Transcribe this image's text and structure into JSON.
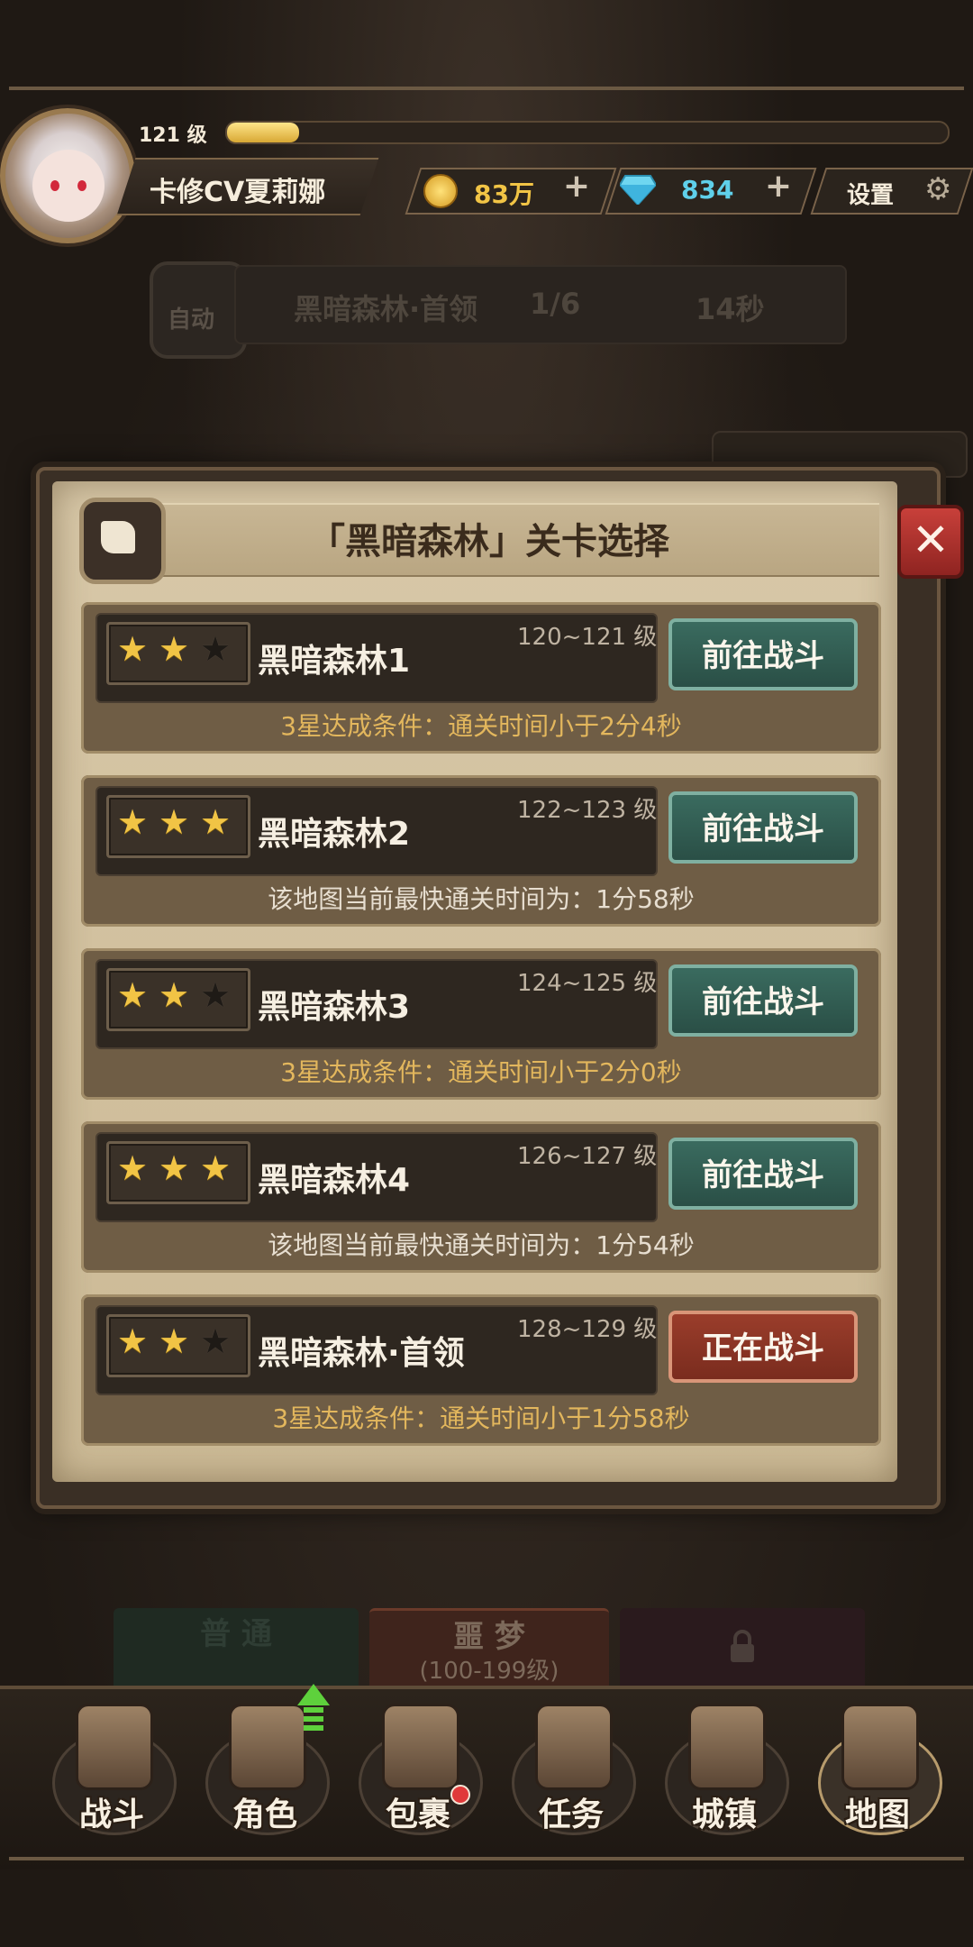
{
  "player": {
    "level_label": "121 级",
    "exp_fraction": 0.1,
    "name": "卡修CV夏莉娜"
  },
  "resources": {
    "gold": "83万",
    "diamonds": "834",
    "settings_label": "设置",
    "plus_label": "+"
  },
  "auto_battle": {
    "badge": "自动",
    "stage": "黑暗森林·首领",
    "progress": "1/6",
    "timer": "14秒"
  },
  "modal": {
    "title": "「黑暗森林」关卡选择",
    "close_label": "✕",
    "levels": [
      {
        "name": "黑暗森林1",
        "range": "120~121 级",
        "stars": 2,
        "button": "前往战斗",
        "button_style": "green",
        "note": "3星达成条件：通关时间小于2分4秒",
        "note_style": "gold"
      },
      {
        "name": "黑暗森林2",
        "range": "122~123 级",
        "stars": 3,
        "button": "前往战斗",
        "button_style": "green",
        "note": "该地图当前最快通关时间为：1分58秒",
        "note_style": "white"
      },
      {
        "name": "黑暗森林3",
        "range": "124~125 级",
        "stars": 2,
        "button": "前往战斗",
        "button_style": "green",
        "note": "3星达成条件：通关时间小于2分0秒",
        "note_style": "gold"
      },
      {
        "name": "黑暗森林4",
        "range": "126~127 级",
        "stars": 3,
        "button": "前往战斗",
        "button_style": "green",
        "note": "该地图当前最快通关时间为：1分54秒",
        "note_style": "white"
      },
      {
        "name": "黑暗森林·首领",
        "range": "128~129 级",
        "stars": 2,
        "button": "正在战斗",
        "button_style": "red",
        "note": "3星达成条件：通关时间小于1分58秒",
        "note_style": "gold"
      }
    ]
  },
  "modes": {
    "normal": "普 通",
    "nightmare": "噩 梦",
    "nightmare_range": "(100-199级)",
    "locked_icon": "lock-icon"
  },
  "nav": [
    {
      "label": "战斗",
      "icon": "battle-icon"
    },
    {
      "label": "角色",
      "icon": "character-icon"
    },
    {
      "label": "包裹",
      "icon": "bag-icon"
    },
    {
      "label": "任务",
      "icon": "quest-icon"
    },
    {
      "label": "城镇",
      "icon": "town-icon"
    },
    {
      "label": "地图",
      "icon": "map-icon"
    }
  ],
  "colors": {
    "gold_text": "#e3b75d",
    "green_button": "#2f5c51",
    "red_button": "#8a3424",
    "diamond_text": "#5fd0ea"
  }
}
